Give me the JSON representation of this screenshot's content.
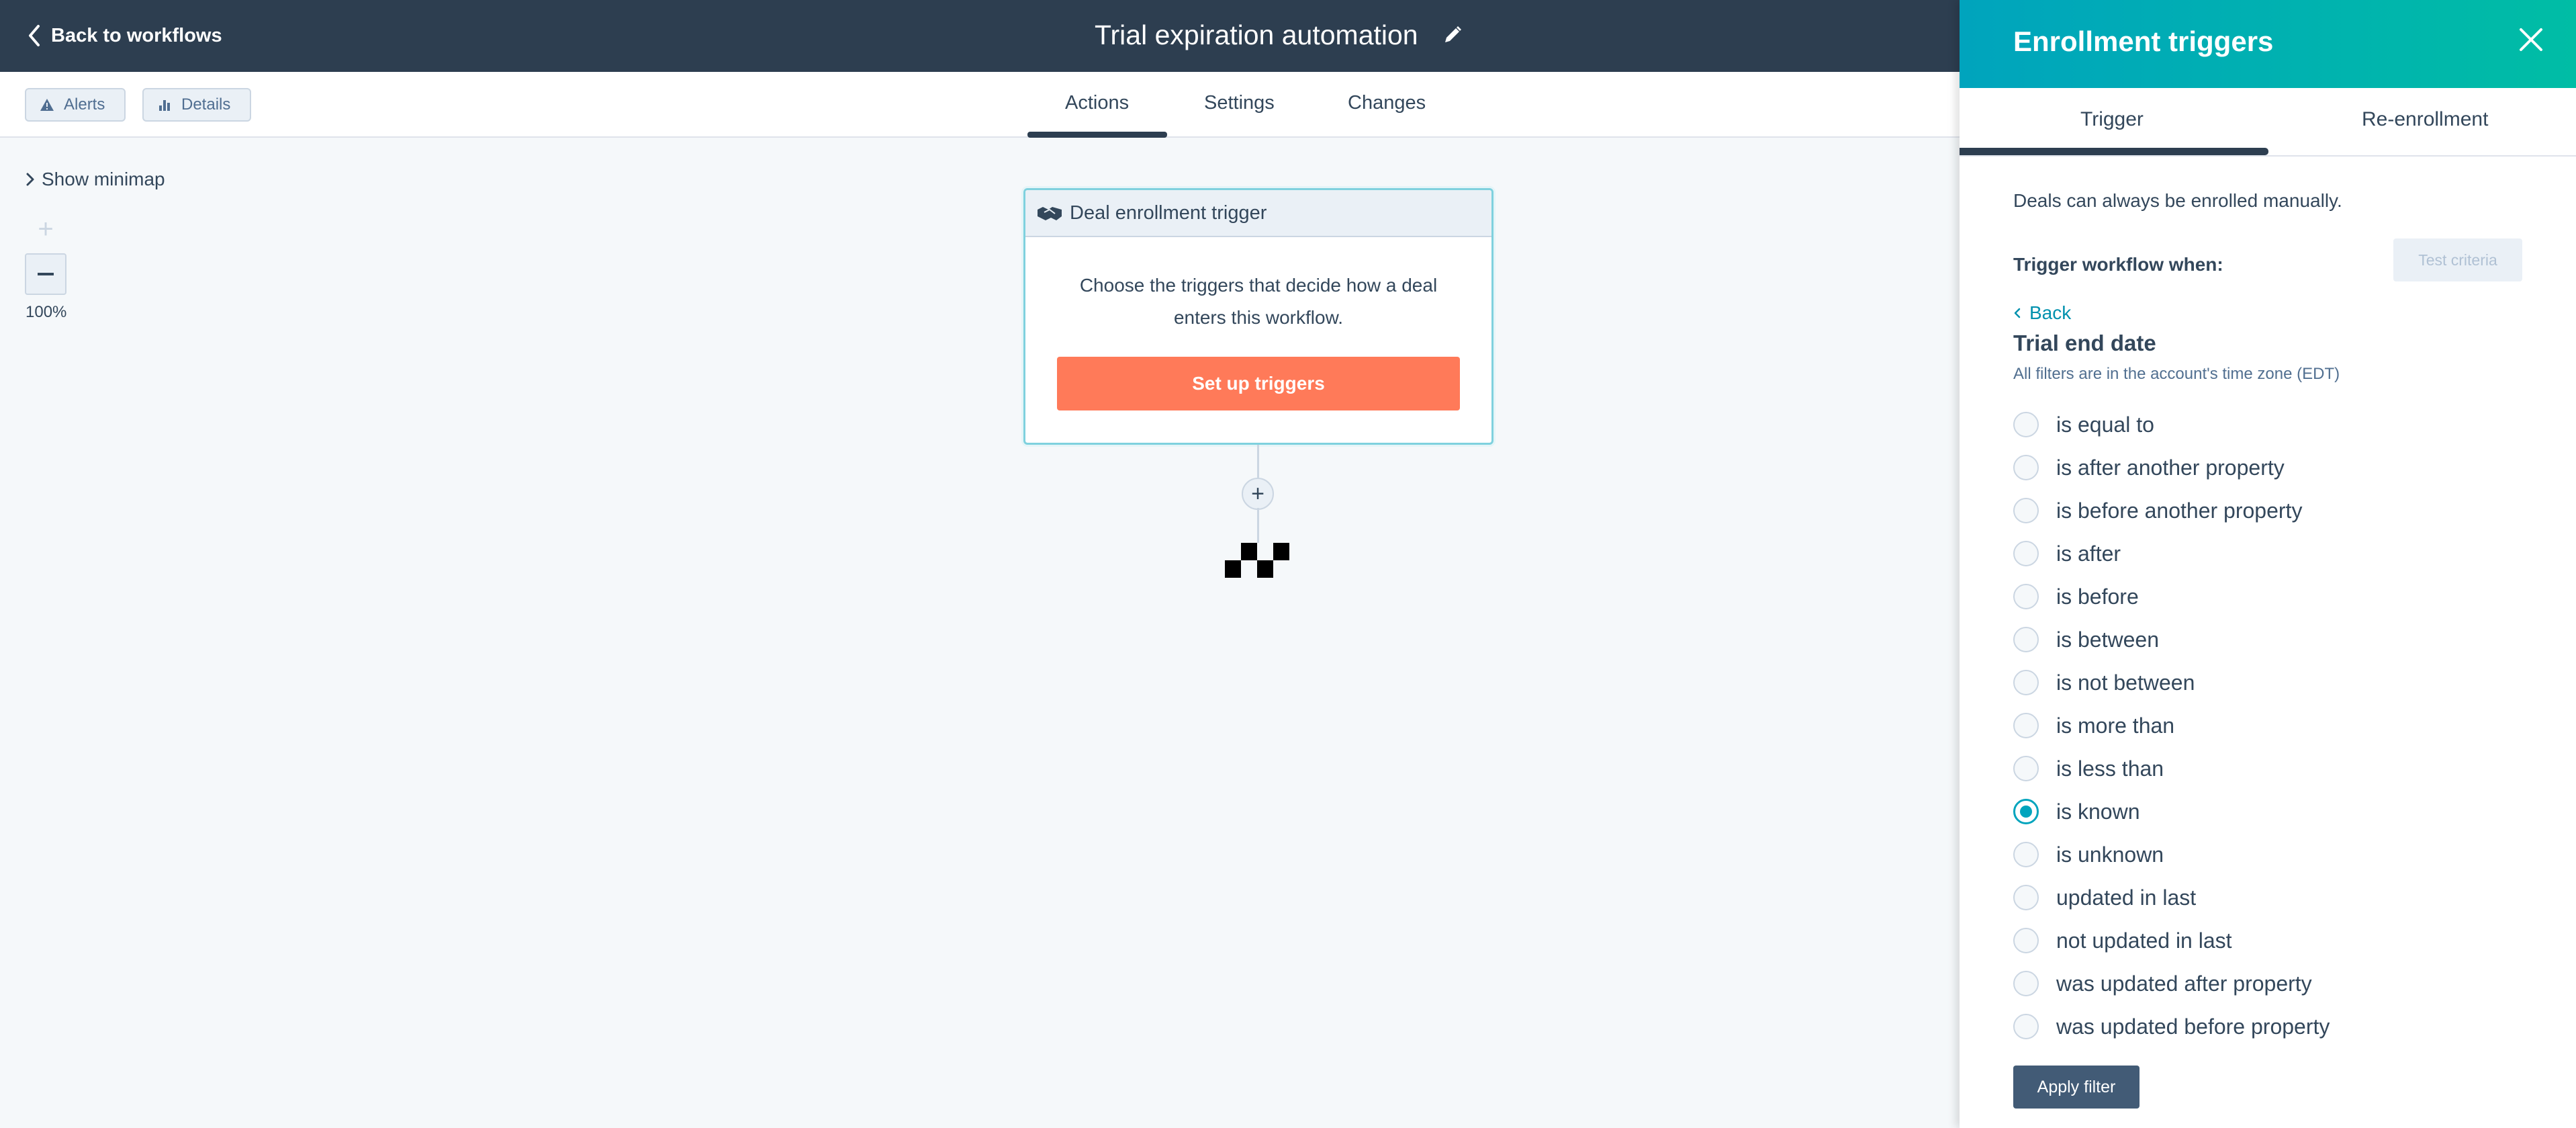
{
  "topbar": {
    "back_label": "Back to workflows",
    "title": "Trial expiration automation"
  },
  "subbar": {
    "alerts_label": "Alerts",
    "details_label": "Details",
    "tabs": [
      {
        "label": "Actions",
        "active": true
      },
      {
        "label": "Settings",
        "active": false
      },
      {
        "label": "Changes",
        "active": false
      }
    ]
  },
  "canvas": {
    "minimap_label": "Show minimap",
    "zoom_in_symbol": "+",
    "zoom_level": "100%",
    "trigger_card": {
      "title": "Deal enrollment trigger",
      "description": "Choose the triggers that decide how a deal enters this workflow.",
      "button_label": "Set up triggers"
    },
    "add_node_symbol": "+"
  },
  "panel": {
    "title": "Enrollment triggers",
    "tabs": [
      {
        "label": "Trigger",
        "active": true
      },
      {
        "label": "Re-enrollment",
        "active": false
      }
    ],
    "manual_note": "Deals can always be enrolled manually.",
    "trigger_when_label": "Trigger workflow when:",
    "test_criteria_label": "Test criteria",
    "back_label": "Back",
    "property_name": "Trial end date",
    "timezone_note": "All filters are in the account's time zone (EDT)",
    "options": [
      {
        "label": "is equal to",
        "checked": false
      },
      {
        "label": "is after another property",
        "checked": false
      },
      {
        "label": "is before another property",
        "checked": false
      },
      {
        "label": "is after",
        "checked": false
      },
      {
        "label": "is before",
        "checked": false
      },
      {
        "label": "is between",
        "checked": false
      },
      {
        "label": "is not between",
        "checked": false
      },
      {
        "label": "is more than",
        "checked": false
      },
      {
        "label": "is less than",
        "checked": false
      },
      {
        "label": "is known",
        "checked": true
      },
      {
        "label": "is unknown",
        "checked": false
      },
      {
        "label": "updated in last",
        "checked": false
      },
      {
        "label": "not updated in last",
        "checked": false
      },
      {
        "label": "was updated after property",
        "checked": false
      },
      {
        "label": "was updated before property",
        "checked": false
      }
    ],
    "apply_label": "Apply filter"
  },
  "colors": {
    "topbar_bg": "#2d3e50",
    "accent_teal": "#00a4bd",
    "cta_orange": "#ff7a59",
    "link_teal": "#0091ae"
  }
}
